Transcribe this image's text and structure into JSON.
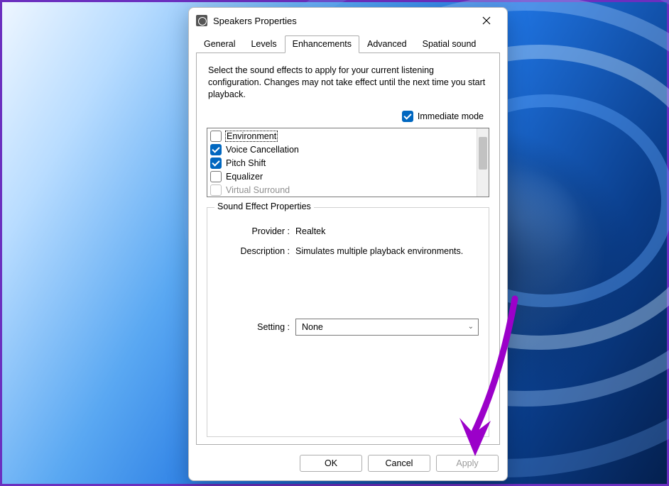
{
  "window": {
    "title": "Speakers Properties"
  },
  "tabs": {
    "items": [
      "General",
      "Levels",
      "Enhancements",
      "Advanced",
      "Spatial sound"
    ],
    "active_index": 2
  },
  "enhancements": {
    "description": "Select the sound effects to apply for your current listening configuration. Changes may not take effect until the next time you start playback.",
    "immediate_mode": {
      "label": "Immediate mode",
      "checked": true
    },
    "effects": [
      {
        "label": "Environment",
        "checked": false,
        "selected": true
      },
      {
        "label": "Voice Cancellation",
        "checked": true,
        "selected": false
      },
      {
        "label": "Pitch Shift",
        "checked": true,
        "selected": false
      },
      {
        "label": "Equalizer",
        "checked": false,
        "selected": false
      },
      {
        "label": "Virtual Surround",
        "checked": false,
        "selected": false
      }
    ],
    "properties": {
      "group_label": "Sound Effect Properties",
      "provider_label": "Provider :",
      "provider_value": "Realtek",
      "description_label": "Description :",
      "description_value": "Simulates multiple playback environments.",
      "setting_label": "Setting :",
      "setting_value": "None"
    }
  },
  "buttons": {
    "ok": "OK",
    "cancel": "Cancel",
    "apply": "Apply"
  },
  "annotation": {
    "arrow_color": "#9b00c9"
  }
}
